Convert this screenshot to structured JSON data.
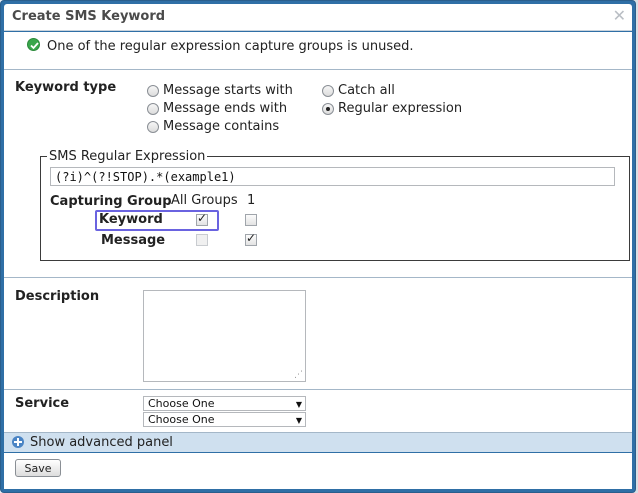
{
  "dialog": {
    "title": "Create SMS Keyword",
    "close_icon": "close-icon"
  },
  "alert": {
    "icon": "check-circle-icon",
    "icon_color": "#3aa64c",
    "message": "One of the regular expression capture groups is unused."
  },
  "keyword_type": {
    "label": "Keyword type",
    "options": [
      {
        "label": "Message starts with",
        "selected": false
      },
      {
        "label": "Message ends with",
        "selected": false
      },
      {
        "label": "Message contains",
        "selected": false
      },
      {
        "label": "Catch all",
        "selected": false
      },
      {
        "label": "Regular expression",
        "selected": true
      }
    ]
  },
  "regex": {
    "legend": "SMS Regular Expression",
    "value": "(?i)^(?!STOP).*(example1)",
    "capturing_group_label": "Capturing Group",
    "columns": [
      "All Groups",
      "1"
    ],
    "rows": [
      {
        "label": "Keyword",
        "all_groups": true,
        "group1": false
      },
      {
        "label": "Message",
        "all_groups": false,
        "group1": true
      }
    ],
    "highlight_color": "#6a63e0"
  },
  "description": {
    "label": "Description",
    "value": ""
  },
  "service": {
    "label": "Service",
    "select1": "Choose One",
    "select2": "Choose One"
  },
  "advanced": {
    "icon": "plus-icon",
    "label": "Show advanced panel"
  },
  "footer": {
    "save_label": "Save"
  },
  "colors": {
    "frame": "#2f6fa6",
    "advanced_bar": "#cfe0ef"
  }
}
